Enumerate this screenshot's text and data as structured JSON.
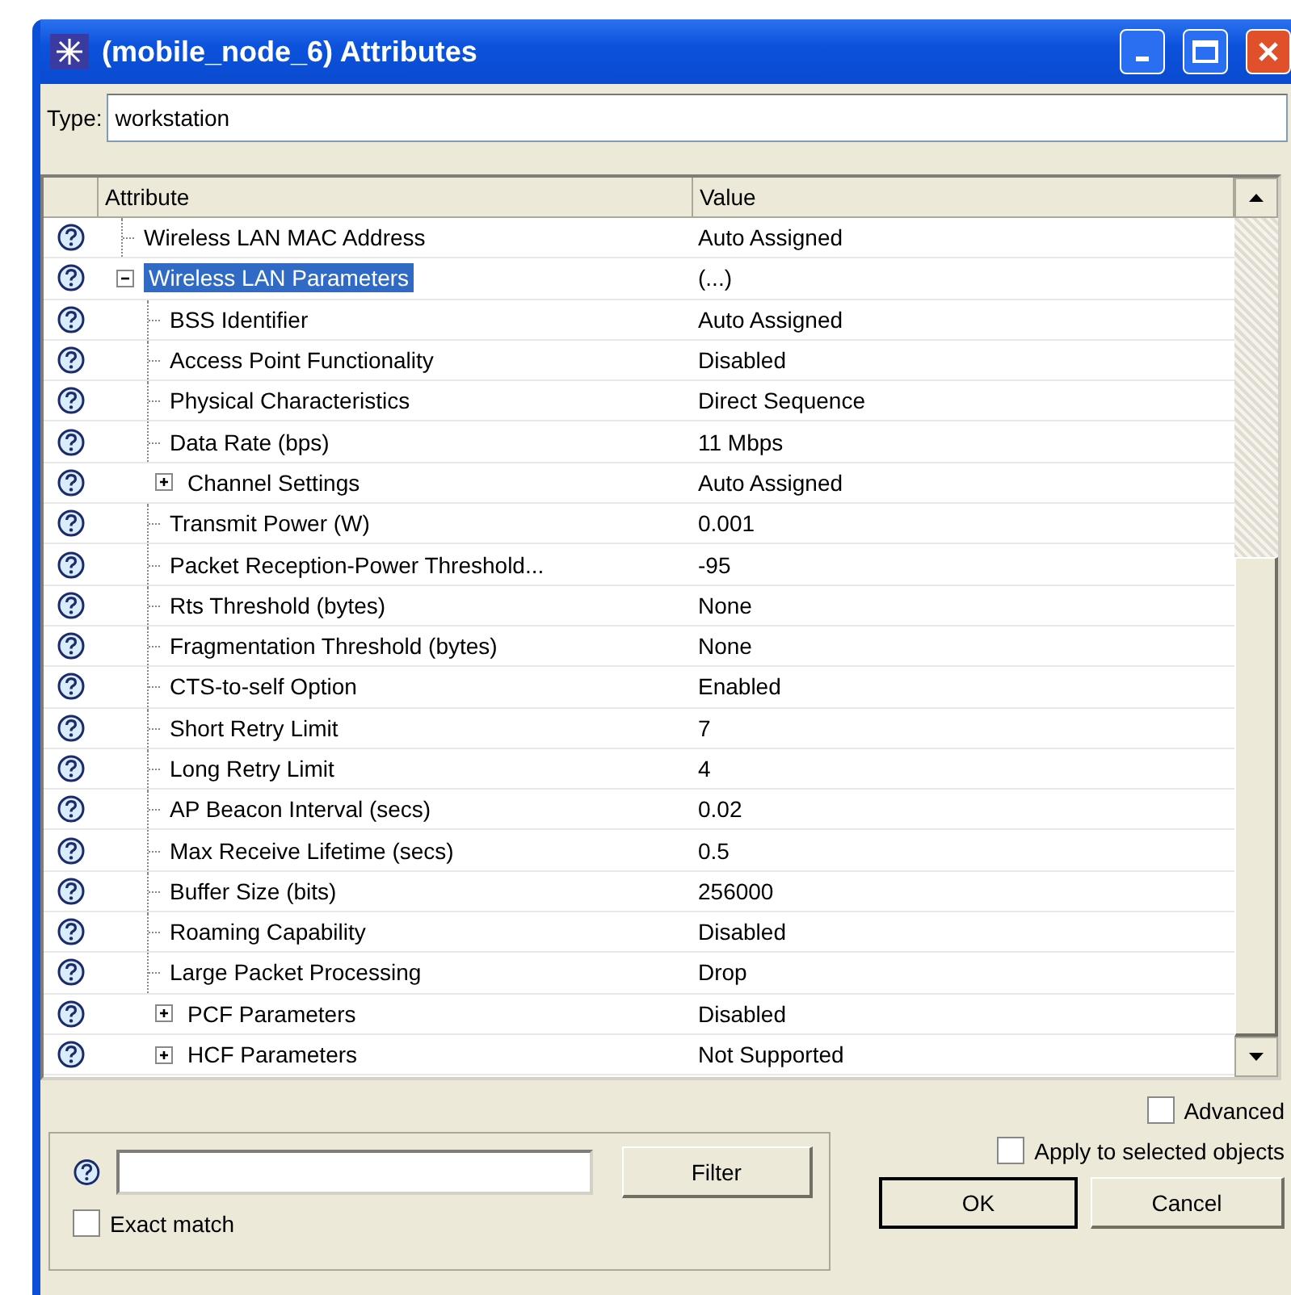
{
  "window": {
    "title": "(mobile_node_6) Attributes"
  },
  "type_field": {
    "label": "Type:",
    "value": "workstation"
  },
  "table": {
    "columns": [
      "Attribute",
      "Value"
    ],
    "rows": [
      {
        "kind": "leaf",
        "name": "Wireless LAN MAC Address",
        "value": "Auto Assigned",
        "selected": false
      },
      {
        "kind": "group",
        "name": "Wireless LAN Parameters",
        "value": "(...)",
        "selected": true,
        "expanded": true,
        "children": [
          {
            "kind": "leaf",
            "name": "BSS Identifier",
            "value": "Auto Assigned",
            "selected": false
          },
          {
            "kind": "leaf",
            "name": "Access Point Functionality",
            "value": "Disabled",
            "selected": false
          },
          {
            "kind": "leaf",
            "name": "Physical Characteristics",
            "value": "Direct Sequence",
            "selected": false
          },
          {
            "kind": "leaf",
            "name": "Data Rate (bps)",
            "value": "11 Mbps",
            "selected": false
          },
          {
            "kind": "group",
            "name": "Channel Settings",
            "value": "Auto Assigned",
            "selected": false,
            "expanded": false
          },
          {
            "kind": "leaf",
            "name": "Transmit Power (W)",
            "value": "0.001",
            "selected": false
          },
          {
            "kind": "leaf",
            "name": "Packet Reception-Power Threshold...",
            "value": "-95",
            "selected": false
          },
          {
            "kind": "leaf",
            "name": "Rts Threshold (bytes)",
            "value": "None",
            "selected": false
          },
          {
            "kind": "leaf",
            "name": "Fragmentation Threshold (bytes)",
            "value": "None",
            "selected": false
          },
          {
            "kind": "leaf",
            "name": "CTS-to-self Option",
            "value": "Enabled",
            "selected": false
          },
          {
            "kind": "leaf",
            "name": "Short Retry Limit",
            "value": "7",
            "selected": false
          },
          {
            "kind": "leaf",
            "name": "Long Retry Limit",
            "value": "4",
            "selected": false
          },
          {
            "kind": "leaf",
            "name": "AP Beacon Interval (secs)",
            "value": "0.02",
            "selected": false
          },
          {
            "kind": "leaf",
            "name": "Max Receive Lifetime (secs)",
            "value": "0.5",
            "selected": false
          },
          {
            "kind": "leaf",
            "name": "Buffer Size (bits)",
            "value": "256000",
            "selected": false
          },
          {
            "kind": "leaf",
            "name": "Roaming Capability",
            "value": "Disabled",
            "selected": false
          },
          {
            "kind": "leaf",
            "name": "Large Packet Processing",
            "value": "Drop",
            "selected": false
          },
          {
            "kind": "group",
            "name": "PCF Parameters",
            "value": "Disabled",
            "selected": false,
            "expanded": false
          },
          {
            "kind": "group",
            "name": "HCF Parameters",
            "value": "Not Supported",
            "selected": false,
            "expanded": false
          }
        ]
      }
    ]
  },
  "filter": {
    "button": "Filter",
    "exact_match": {
      "label": "Exact match",
      "checked": false
    }
  },
  "advanced": {
    "label": "Advanced",
    "checked": false
  },
  "apply_selected": {
    "label": "Apply to selected objects",
    "checked": false
  },
  "buttons": [
    "OK",
    "Cancel"
  ]
}
